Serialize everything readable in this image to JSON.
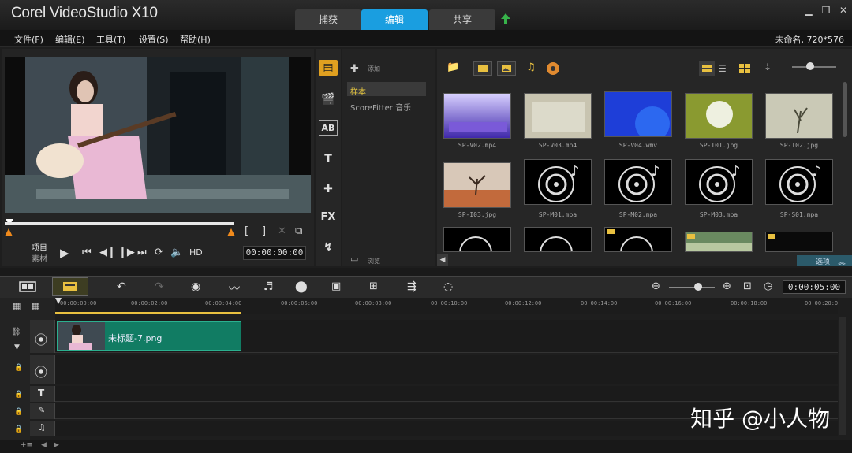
{
  "app": {
    "logo": "Corel VideoStudio X10",
    "tabs": [
      "捕获",
      "编辑",
      "共享"
    ],
    "active_tab": "编辑"
  },
  "menu": {
    "items": [
      "文件(F)",
      "编辑(E)",
      "工具(T)",
      "设置(S)",
      "帮助(H)"
    ],
    "project_info": "未命名, 720*576"
  },
  "player": {
    "project_label": "项目",
    "clip_label": "素材",
    "hd_label": "HD",
    "timecode": "00:00:00:00"
  },
  "library": {
    "add_label": "添加",
    "folders": [
      "样本",
      "ScoreFitter 音乐"
    ],
    "browse_label": "浏览",
    "options_label": "选项",
    "items": [
      {
        "name": "SP-V02.mp4",
        "kind": "video"
      },
      {
        "name": "SP-V03.mp4",
        "kind": "video"
      },
      {
        "name": "SP-V04.wmv",
        "kind": "video"
      },
      {
        "name": "SP-I01.jpg",
        "kind": "image"
      },
      {
        "name": "SP-I02.jpg",
        "kind": "image"
      },
      {
        "name": "SP-I03.jpg",
        "kind": "image"
      },
      {
        "name": "SP-M01.mpa",
        "kind": "audio"
      },
      {
        "name": "SP-M02.mpa",
        "kind": "audio"
      },
      {
        "name": "SP-M03.mpa",
        "kind": "audio"
      },
      {
        "name": "SP-S01.mpa",
        "kind": "audio"
      }
    ]
  },
  "timeline": {
    "total_time": "0:00:05:00",
    "ticks": [
      "00:00:00:00",
      "00:00:02:00",
      "00:00:04:00",
      "00:00:06:00",
      "00:00:08:00",
      "00:00:10:00",
      "00:00:12:00",
      "00:00:14:00",
      "00:00:16:00",
      "00:00:18:00",
      "00:00:20:0"
    ],
    "clip_name": "未标题-7.png"
  },
  "watermark": "知乎 @小人物",
  "colors": {
    "accent": "#1a9ee0",
    "clip": "#117c63"
  }
}
